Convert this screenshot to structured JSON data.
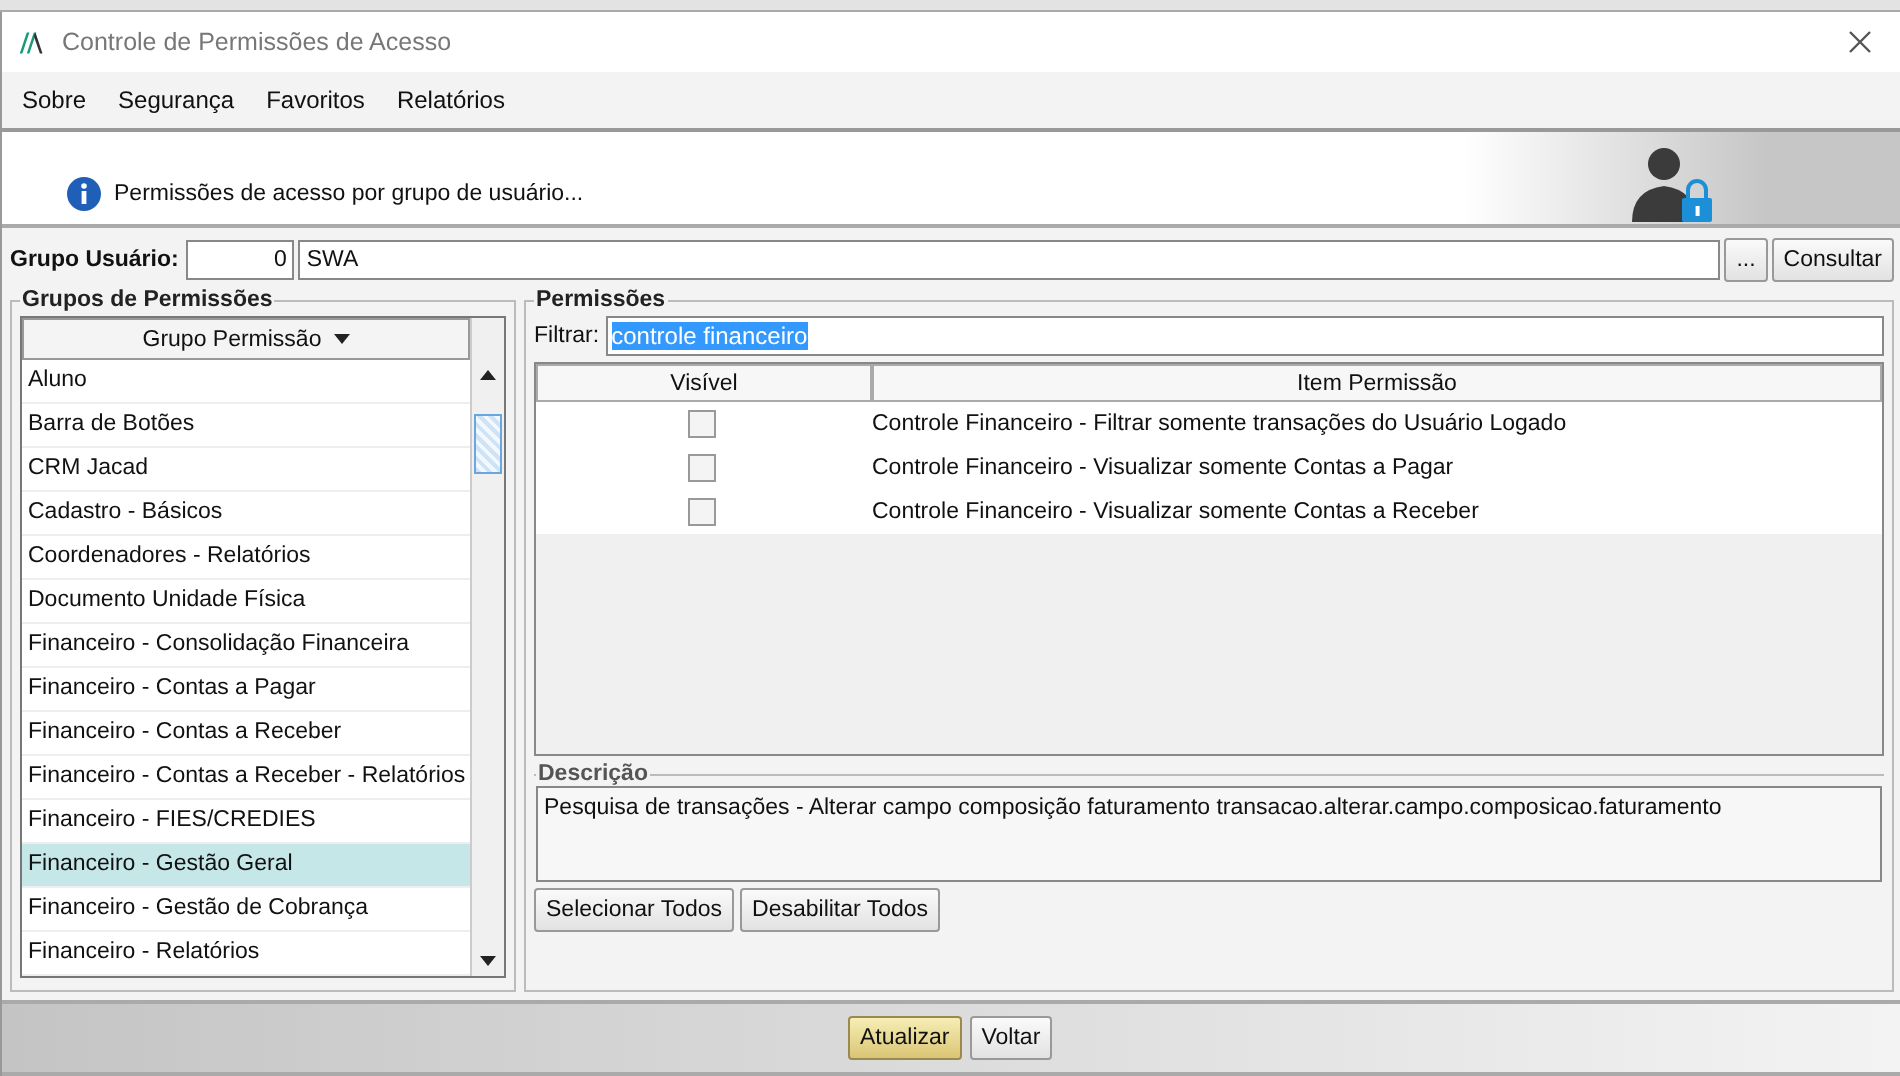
{
  "window": {
    "title": "Controle de Permissões de Acesso"
  },
  "menu": [
    "Sobre",
    "Segurança",
    "Favoritos",
    "Relatórios"
  ],
  "banner": {
    "text": "Permissões de acesso por grupo de usuário..."
  },
  "group_user": {
    "label": "Grupo Usuário:",
    "code": "0",
    "name": "SWA",
    "browse_button": "...",
    "query_button": "Consultar"
  },
  "groups_panel": {
    "title": "Grupos de Permissões",
    "column": "Grupo Permissão",
    "items": [
      {
        "label": "Aluno",
        "selected": false
      },
      {
        "label": "Barra de Botões",
        "selected": false
      },
      {
        "label": "CRM Jacad",
        "selected": false
      },
      {
        "label": "Cadastro - Básicos",
        "selected": false
      },
      {
        "label": "Coordenadores - Relatórios",
        "selected": false
      },
      {
        "label": "Documento Unidade Física",
        "selected": false
      },
      {
        "label": "Financeiro - Consolidação Financeira",
        "selected": false
      },
      {
        "label": "Financeiro - Contas a Pagar",
        "selected": false
      },
      {
        "label": "Financeiro - Contas a Receber",
        "selected": false
      },
      {
        "label": "Financeiro - Contas a Receber - Relatórios",
        "selected": false
      },
      {
        "label": "Financeiro - FIES/CREDIES",
        "selected": false
      },
      {
        "label": "Financeiro - Gestão Geral",
        "selected": true
      },
      {
        "label": "Financeiro - Gestão de Cobrança",
        "selected": false
      },
      {
        "label": "Financeiro - Relatórios",
        "selected": false
      }
    ]
  },
  "permissions_panel": {
    "title": "Permissões",
    "filter_label": "Filtrar:",
    "filter_value": "controle financeiro",
    "filter_text_selected": true,
    "columns": [
      "Visível",
      "Item Permissão"
    ],
    "rows": [
      {
        "visible": false,
        "item": "Controle Financeiro - Filtrar somente transações do Usuário Logado"
      },
      {
        "visible": false,
        "item": "Controle Financeiro - Visualizar somente Contas a Pagar"
      },
      {
        "visible": false,
        "item": "Controle Financeiro - Visualizar somente Contas a Receber"
      }
    ],
    "description_title": "Descrição",
    "description": "Pesquisa de transações - Alterar campo composição faturamento transacao.alterar.campo.composicao.faturamento",
    "buttons": [
      "Selecionar Todos",
      "Desabilitar Todos"
    ]
  },
  "footer_buttons": [
    {
      "label": "Atualizar",
      "default": true
    },
    {
      "label": "Voltar",
      "default": false
    }
  ]
}
